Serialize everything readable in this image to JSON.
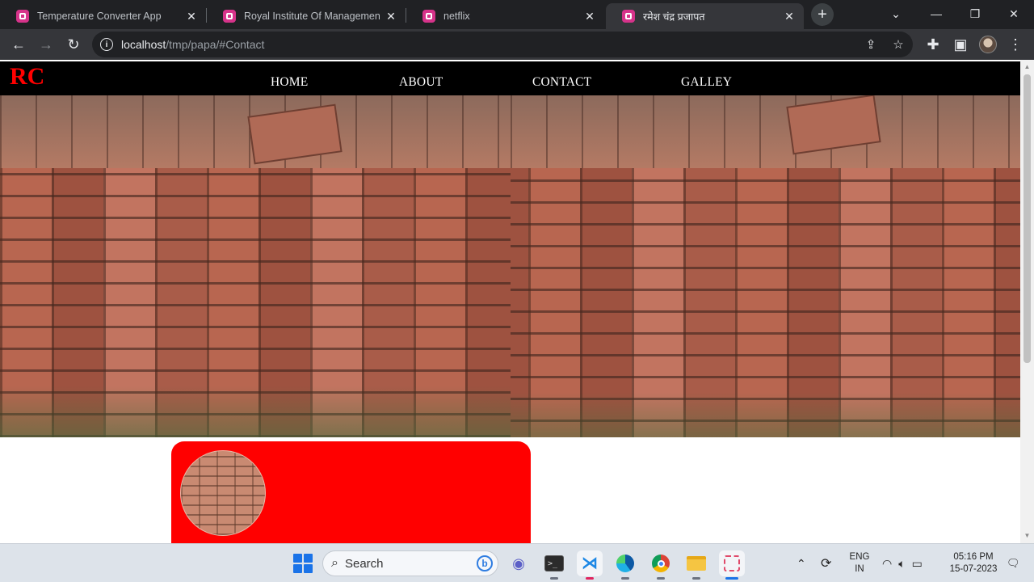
{
  "browser": {
    "tabs": [
      {
        "title": "Temperature Converter App",
        "active": false
      },
      {
        "title": "Royal Institute Of Management C",
        "active": false
      },
      {
        "title": "netflix",
        "active": false
      },
      {
        "title": "रमेश चंद्र प्रजापत",
        "active": true
      }
    ],
    "url_host": "localhost",
    "url_path": "/tmp/papa/#Contact",
    "favicon_color": "#d6338a"
  },
  "site": {
    "logo": "RC",
    "logo_color": "#ff0000",
    "nav": [
      "HOME",
      "ABOUT",
      "CONTACT",
      "GALLEY"
    ],
    "hero_images": [
      "bricks-photo",
      "bricks-photo"
    ],
    "contact_card_color": "#ff0000"
  },
  "taskbar": {
    "search_placeholder": "Search",
    "apps": [
      "teams-icon",
      "terminal-icon",
      "vscode-icon",
      "edge-icon",
      "chrome-icon",
      "file-explorer-icon",
      "snipping-tool-icon"
    ],
    "language_line1": "ENG",
    "language_line2": "IN",
    "time": "05:16 PM",
    "date": "15-07-2023"
  }
}
